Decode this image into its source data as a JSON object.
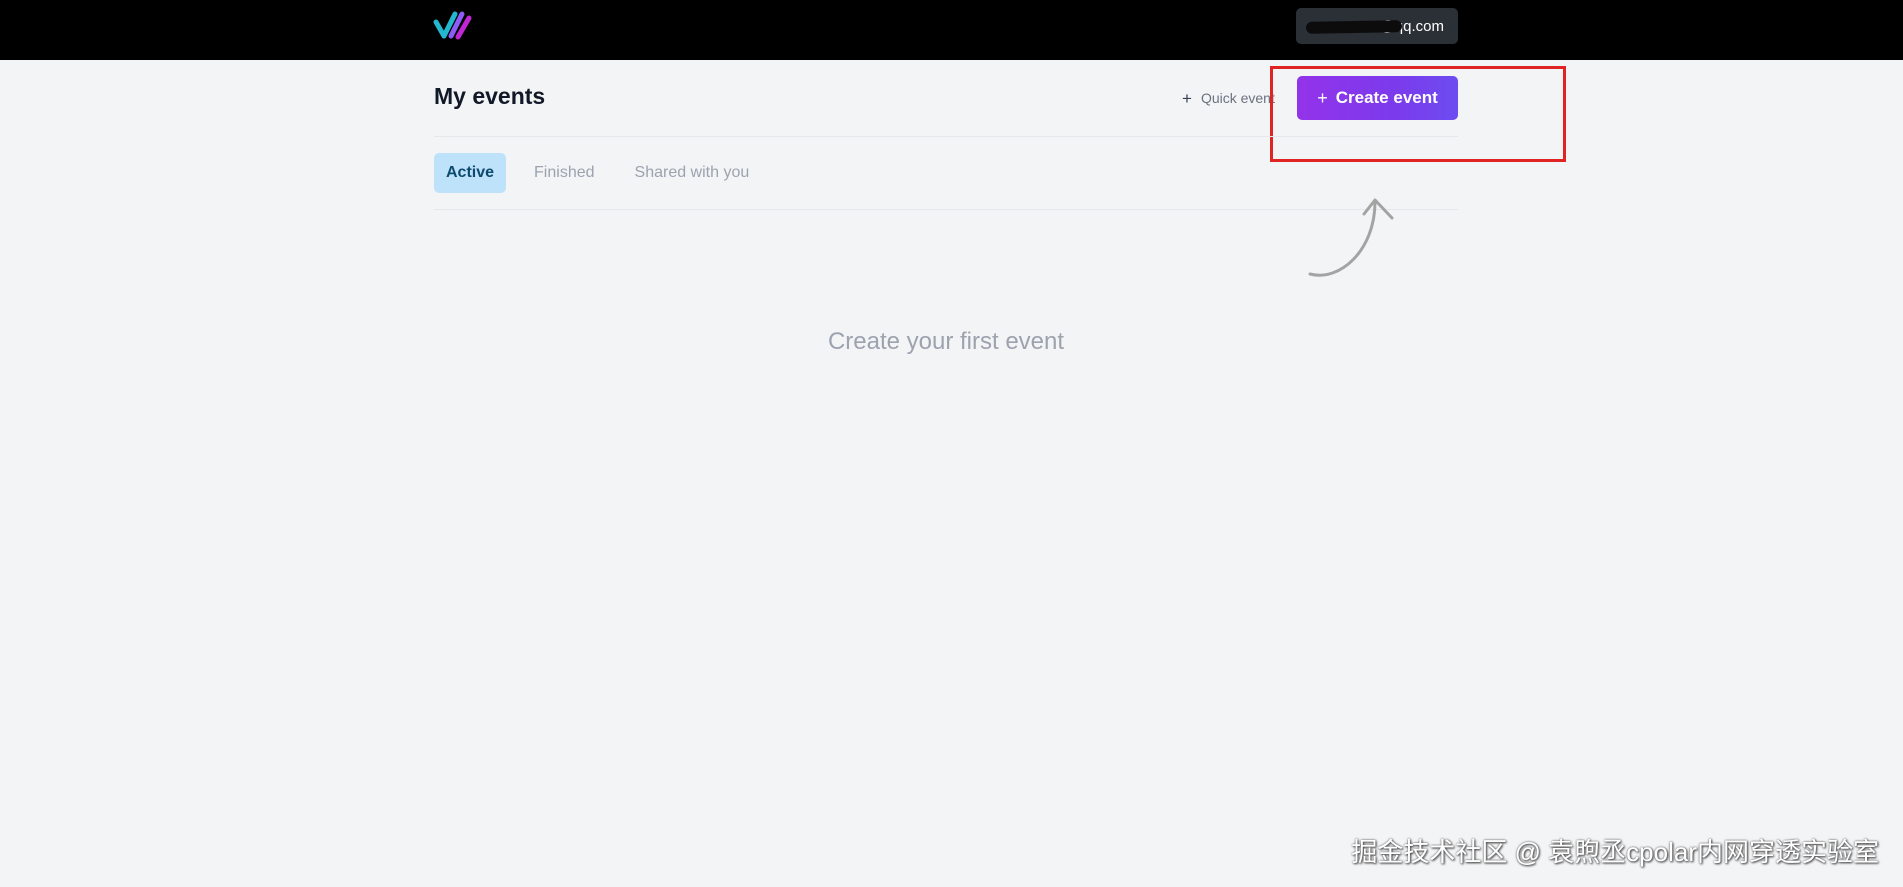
{
  "header": {
    "user_email_suffix": "@qq.com"
  },
  "page": {
    "title": "My events",
    "quick_event_label": "Quick event",
    "create_event_label": "Create event"
  },
  "tabs": [
    {
      "label": "Active",
      "active": true
    },
    {
      "label": "Finished",
      "active": false
    },
    {
      "label": "Shared with you",
      "active": false
    }
  ],
  "empty_state": {
    "message": "Create your first event"
  },
  "watermark": {
    "text": "掘金技术社区 @ 袁煦丞cpolar内网穿透实验室"
  },
  "colors": {
    "topbar": "#000000",
    "background": "#f3f4f6",
    "primary": "#7c3aed",
    "active_tab_bg": "#bfe2fb",
    "highlight": "#e02424"
  },
  "icons": {
    "logo": "slashes-logo-icon",
    "plus": "plus-icon",
    "arrow": "curved-arrow-icon"
  }
}
